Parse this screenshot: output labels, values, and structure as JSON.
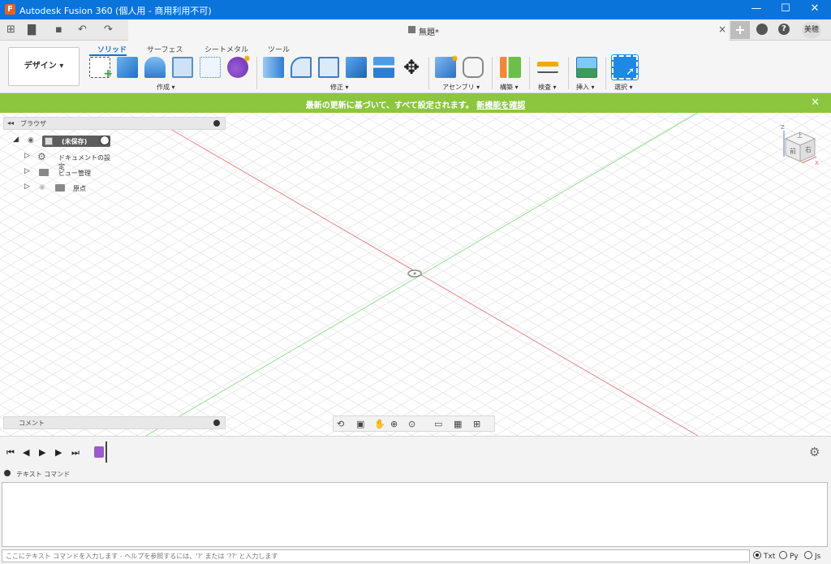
{
  "window": {
    "title": "Autodesk Fusion 360 (個人用 - 商用利用不可)",
    "minimize": "—",
    "maximize": "☐",
    "close": "✕",
    "logo_letter": "F"
  },
  "quick_access": {
    "grid": "⊞",
    "file": "▇",
    "save": "▪",
    "undo": "↶",
    "redo": "↷"
  },
  "doc_tab": {
    "name": "無題*",
    "close": "×",
    "new_tab": "+",
    "user": "美穂"
  },
  "ribbon": {
    "workspace": "デザイン ▾",
    "tabs": [
      "ソリッド",
      "サーフェス",
      "シートメタル",
      "ツール"
    ],
    "groups": [
      "作成 ▾",
      "修正 ▾",
      "アセンブリ ▾",
      "構築 ▾",
      "検査 ▾",
      "挿入 ▾",
      "選択 ▾"
    ]
  },
  "banner": {
    "message": "最新の更新に基づいて、すべて設定されます。",
    "link": "新機能を確認",
    "close": "✕"
  },
  "browser": {
    "title": "ブラウザ",
    "collapse": "◂◂",
    "items": [
      {
        "label": "(未保存)"
      },
      {
        "label": "ドキュメントの設定"
      },
      {
        "label": "ビュー管理"
      },
      {
        "label": "原点"
      }
    ]
  },
  "comments": {
    "title": "コメント"
  },
  "viewcube": {
    "front": "前",
    "right": "右",
    "top": "上",
    "z": "Z",
    "x": "X"
  },
  "timeline": {
    "first": "⏮",
    "prev": "◀",
    "play": "▶",
    "next": "▶",
    "last": "⏭",
    "settings": "⚙"
  },
  "text_command": {
    "title": "テキスト コマンド",
    "placeholder": "ここにテキスト コマンドを入力します - ヘルプを参照するには、'?' または '??' と入力します",
    "modes": [
      "Txt",
      "Py",
      "Js"
    ],
    "selected_mode": "Txt"
  },
  "colors": {
    "accent": "#0a74da",
    "banner": "#8cc63f",
    "x_axis": "#f08080",
    "y_axis": "#90e090"
  }
}
